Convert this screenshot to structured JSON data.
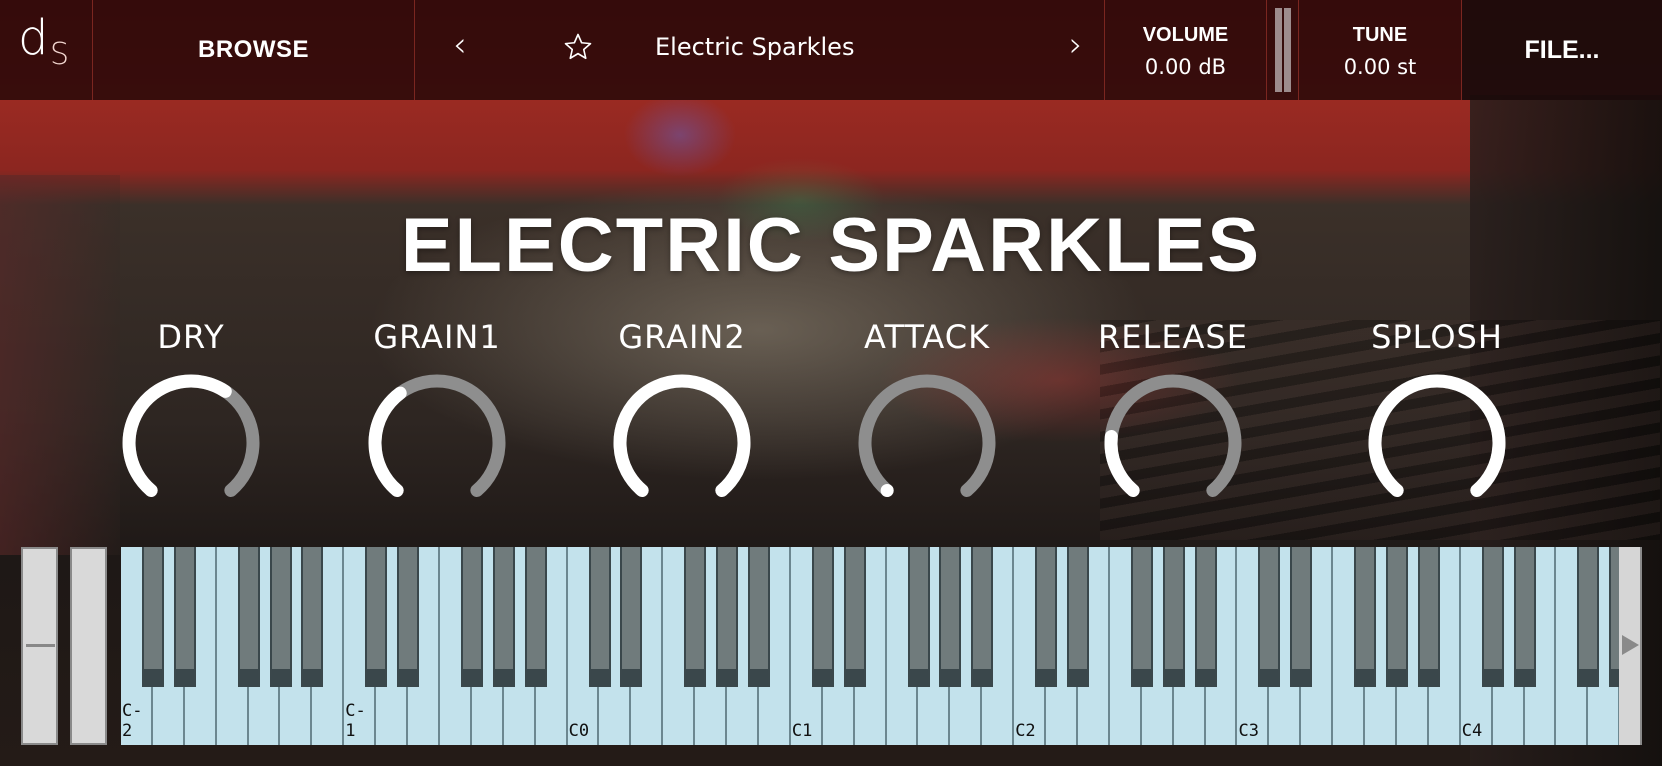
{
  "header": {
    "logo": {
      "d": "d",
      "s": "S"
    },
    "browse_label": "BROWSE",
    "preset_name": "Electric Sparkles",
    "prev_icon": "chevron-left-icon",
    "next_icon": "chevron-right-icon",
    "favorite_icon": "star-outline-icon",
    "volume": {
      "label": "VOLUME",
      "value": "0.00 dB"
    },
    "tune": {
      "label": "TUNE",
      "value": "0.00 st"
    },
    "file_label": "FILE..."
  },
  "title": "ELECTRIC SPARKLES",
  "colors": {
    "knob_active": "#ffffff",
    "knob_track": "#8e8e8e",
    "white_key": "#c3e2ec",
    "black_key": "#707b7c",
    "header_border": "#7b2620"
  },
  "knobs": [
    {
      "label": "DRY",
      "value": 0.62
    },
    {
      "label": "GRAIN1",
      "value": 0.37
    },
    {
      "label": "GRAIN2",
      "value": 1.0
    },
    {
      "label": "ATTACK",
      "value": 0.0
    },
    {
      "label": "RELEASE",
      "value": 0.2
    },
    {
      "label": "SPLOSH",
      "value": 1.0
    }
  ],
  "keyboard": {
    "octave_labels": [
      "C-2",
      "C-1",
      "C0",
      "C1",
      "C2",
      "C3",
      "C4"
    ],
    "white_key_count": 47,
    "scroll_right_icon": "triangle-right-icon"
  },
  "wheels": {
    "pitch": {
      "label": "pitch-wheel",
      "value": 0.5
    },
    "mod": {
      "label": "mod-wheel",
      "value": 0.0
    }
  }
}
